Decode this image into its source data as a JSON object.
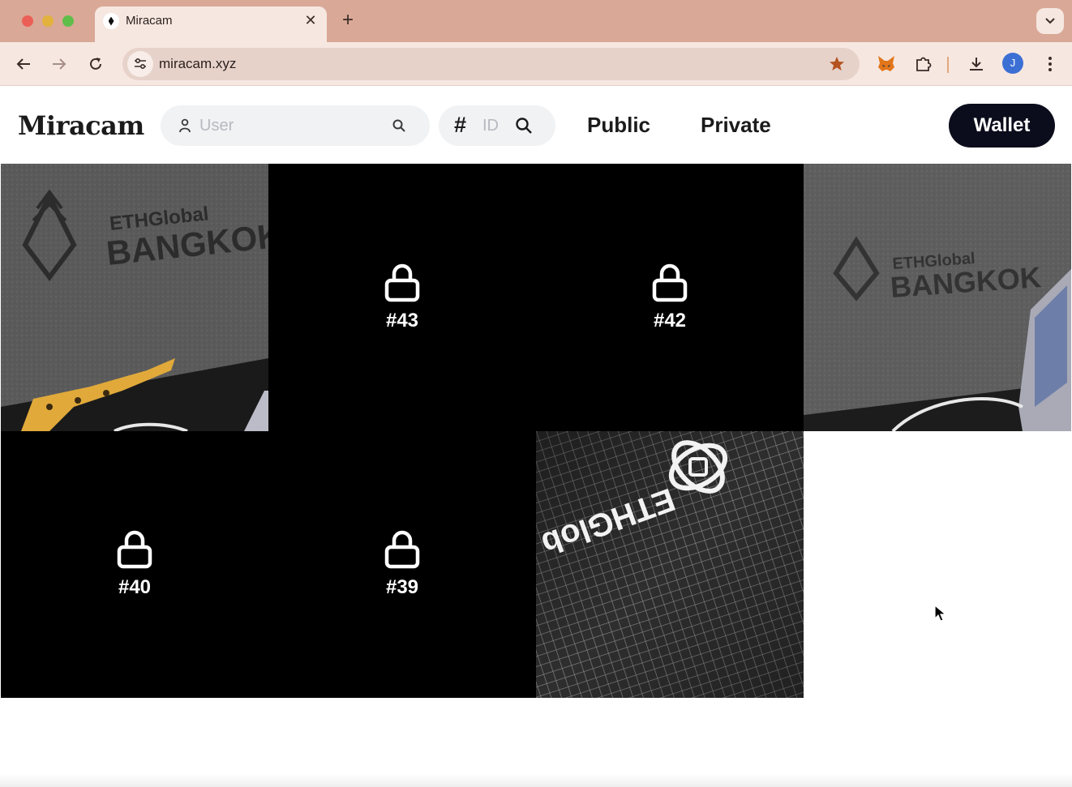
{
  "browser": {
    "tab_title": "Miracam",
    "url": "miracam.xyz",
    "profile_initial": "J"
  },
  "app": {
    "logo": "Miracam",
    "user_search": {
      "placeholder": "User",
      "value": ""
    },
    "id_search": {
      "symbol": "#",
      "placeholder": "ID",
      "value": ""
    },
    "nav": {
      "public_label": "Public",
      "private_label": "Private"
    },
    "wallet_label": "Wallet"
  },
  "gallery": {
    "items": [
      {
        "type": "photo",
        "text_line1": "ETHGlobal",
        "text_line2": "BANGKOK"
      },
      {
        "type": "locked",
        "label": "#43"
      },
      {
        "type": "locked",
        "label": "#42"
      },
      {
        "type": "photo",
        "text_line1": "ETHGlobal",
        "text_line2": "BANGKOK"
      },
      {
        "type": "locked",
        "label": "#40"
      },
      {
        "type": "locked",
        "label": "#39"
      },
      {
        "type": "photo",
        "text_line1": "ETHGlob"
      },
      {
        "type": "empty"
      }
    ]
  },
  "colors": {
    "titlebar": "#d9a896",
    "toolbar": "#f6e7e1",
    "wallet_button": "#0b0d1c",
    "locked_tile": "#000000",
    "bookmark_star": "#b4531f"
  }
}
